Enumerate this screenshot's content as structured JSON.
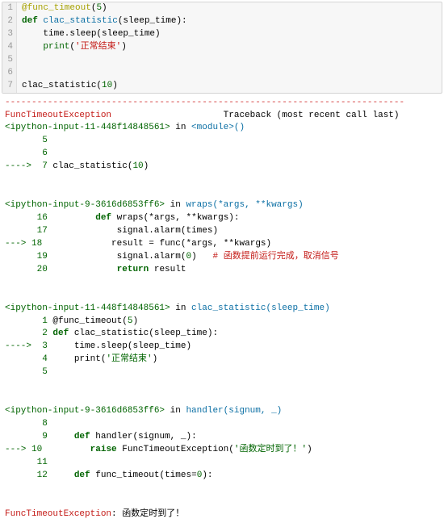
{
  "code_cell": {
    "lines": [
      {
        "n": "1",
        "i": 0,
        "parts": [
          {
            "t": "@func_timeout",
            "c": "dec"
          },
          {
            "t": "("
          },
          {
            "t": "5",
            "c": "num"
          },
          {
            "t": ")"
          }
        ]
      },
      {
        "n": "2",
        "i": 0,
        "parts": [
          {
            "t": "def ",
            "c": "kw"
          },
          {
            "t": "clac_statistic",
            "c": "fn"
          },
          {
            "t": "(sleep_time):"
          }
        ]
      },
      {
        "n": "3",
        "i": 1,
        "parts": [
          {
            "t": "time.sleep(sleep_time)"
          }
        ]
      },
      {
        "n": "4",
        "i": 1,
        "parts": [
          {
            "t": "print",
            "c": "bi"
          },
          {
            "t": "("
          },
          {
            "t": "'正常结束'",
            "c": "str"
          },
          {
            "t": ")"
          }
        ]
      },
      {
        "n": "5",
        "i": 0,
        "parts": []
      },
      {
        "n": "6",
        "i": 0,
        "parts": []
      },
      {
        "n": "7",
        "i": 0,
        "parts": [
          {
            "t": "clac_statistic("
          },
          {
            "t": "10",
            "c": "num"
          },
          {
            "t": ")"
          }
        ]
      }
    ]
  },
  "traceback": {
    "dashes": "---------------------------------------------------------------------------",
    "exc_header_name": "FuncTimeoutException",
    "exc_header_tb": "Traceback (most recent call last)",
    "frames": [
      {
        "ref": "<ipython-input-11-448f14848561>",
        "where": " in ",
        "loc": "<module>",
        "args": "()",
        "lines": [
          {
            "marker": "",
            "no": "5",
            "i": 0,
            "parts": []
          },
          {
            "marker": "",
            "no": "6",
            "i": 0,
            "parts": []
          },
          {
            "marker": "----> ",
            "no": "7",
            "i": 0,
            "parts": [
              {
                "t": "clac_statistic"
              },
              {
                "t": "("
              },
              {
                "t": "10",
                "c": "link"
              },
              {
                "t": ")"
              }
            ]
          }
        ]
      },
      {
        "ref": "<ipython-input-9-3616d6853ff6>",
        "where": " in ",
        "loc": "wraps",
        "args": "(*args, **kwargs)",
        "lines": [
          {
            "marker": "",
            "no": "16",
            "i": 2,
            "parts": [
              {
                "t": "def",
                "c": "kw"
              },
              {
                "t": " wraps"
              },
              {
                "t": "("
              },
              {
                "t": "*",
                "c": "kwarg"
              },
              {
                "t": "args"
              },
              {
                "t": ", "
              },
              {
                "t": "**",
                "c": "kwarg"
              },
              {
                "t": "kwargs"
              },
              {
                "t": ")"
              },
              {
                "t": ":"
              }
            ]
          },
          {
            "marker": "",
            "no": "17",
            "i": 3,
            "parts": [
              {
                "t": "signal"
              },
              {
                "t": "."
              },
              {
                "t": "alarm"
              },
              {
                "t": "("
              },
              {
                "t": "times"
              },
              {
                "t": ")"
              }
            ]
          },
          {
            "marker": "---> ",
            "no": "18",
            "i": 3,
            "parts": [
              {
                "t": "result "
              },
              {
                "t": "=",
                "c": "kwarg"
              },
              {
                "t": " func"
              },
              {
                "t": "("
              },
              {
                "t": "*",
                "c": "kwarg"
              },
              {
                "t": "args"
              },
              {
                "t": ", "
              },
              {
                "t": "**",
                "c": "kwarg"
              },
              {
                "t": "kwargs"
              },
              {
                "t": ")"
              }
            ]
          },
          {
            "marker": "",
            "no": "19",
            "i": 3,
            "parts": [
              {
                "t": "signal"
              },
              {
                "t": "."
              },
              {
                "t": "alarm"
              },
              {
                "t": "("
              },
              {
                "t": "0",
                "c": "link"
              },
              {
                "t": ")"
              },
              {
                "t": "   "
              },
              {
                "t": "# 函数提前运行完成，取消信号",
                "c": "cm"
              }
            ]
          },
          {
            "marker": "",
            "no": "20",
            "i": 3,
            "parts": [
              {
                "t": "return",
                "c": "kw"
              },
              {
                "t": " result"
              }
            ]
          }
        ]
      },
      {
        "ref": "<ipython-input-11-448f14848561>",
        "where": " in ",
        "loc": "clac_statistic",
        "args": "(sleep_time)",
        "lines": [
          {
            "marker": "",
            "no": "1",
            "i": 0,
            "parts": [
              {
                "t": "@func_timeout"
              },
              {
                "t": "("
              },
              {
                "t": "5",
                "c": "link"
              },
              {
                "t": ")"
              }
            ]
          },
          {
            "marker": "",
            "no": "2",
            "i": 0,
            "parts": [
              {
                "t": "def",
                "c": "kw"
              },
              {
                "t": " clac_statistic"
              },
              {
                "t": "("
              },
              {
                "t": "sleep_time"
              },
              {
                "t": ")"
              },
              {
                "t": ":"
              }
            ]
          },
          {
            "marker": "----> ",
            "no": "3",
            "i": 1,
            "parts": [
              {
                "t": "time"
              },
              {
                "t": "."
              },
              {
                "t": "sleep"
              },
              {
                "t": "("
              },
              {
                "t": "sleep_time"
              },
              {
                "t": ")"
              }
            ]
          },
          {
            "marker": "",
            "no": "4",
            "i": 1,
            "parts": [
              {
                "t": "print"
              },
              {
                "t": "("
              },
              {
                "t": "'正常结束'",
                "c": "link"
              },
              {
                "t": ")"
              }
            ]
          },
          {
            "marker": "",
            "no": "5",
            "i": 0,
            "parts": []
          }
        ]
      },
      {
        "ref": "<ipython-input-9-3616d6853ff6>",
        "where": " in ",
        "loc": "handler",
        "args": "(signum, _)",
        "lines": [
          {
            "marker": "",
            "no": "8",
            "i": 0,
            "parts": []
          },
          {
            "marker": "",
            "no": "9",
            "i": 1,
            "parts": [
              {
                "t": "def",
                "c": "kw"
              },
              {
                "t": " handler"
              },
              {
                "t": "("
              },
              {
                "t": "signum"
              },
              {
                "t": ", "
              },
              {
                "t": "_"
              },
              {
                "t": ")"
              },
              {
                "t": ":"
              }
            ]
          },
          {
            "marker": "---> ",
            "no": "10",
            "i": 2,
            "parts": [
              {
                "t": "raise",
                "c": "kw"
              },
              {
                "t": " FuncTimeoutException"
              },
              {
                "t": "("
              },
              {
                "t": "'函数定时到了！'",
                "c": "link"
              },
              {
                "t": ")"
              }
            ]
          },
          {
            "marker": "",
            "no": "11",
            "i": 0,
            "parts": []
          },
          {
            "marker": "",
            "no": "12",
            "i": 1,
            "parts": [
              {
                "t": "def",
                "c": "kw"
              },
              {
                "t": " func_timeout"
              },
              {
                "t": "("
              },
              {
                "t": "times"
              },
              {
                "t": "=",
                "c": "kwarg"
              },
              {
                "t": "0",
                "c": "link"
              },
              {
                "t": ")"
              },
              {
                "t": ":"
              }
            ]
          }
        ]
      }
    ],
    "final_exc": "FuncTimeoutException",
    "final_msg": ": 函数定时到了！"
  }
}
